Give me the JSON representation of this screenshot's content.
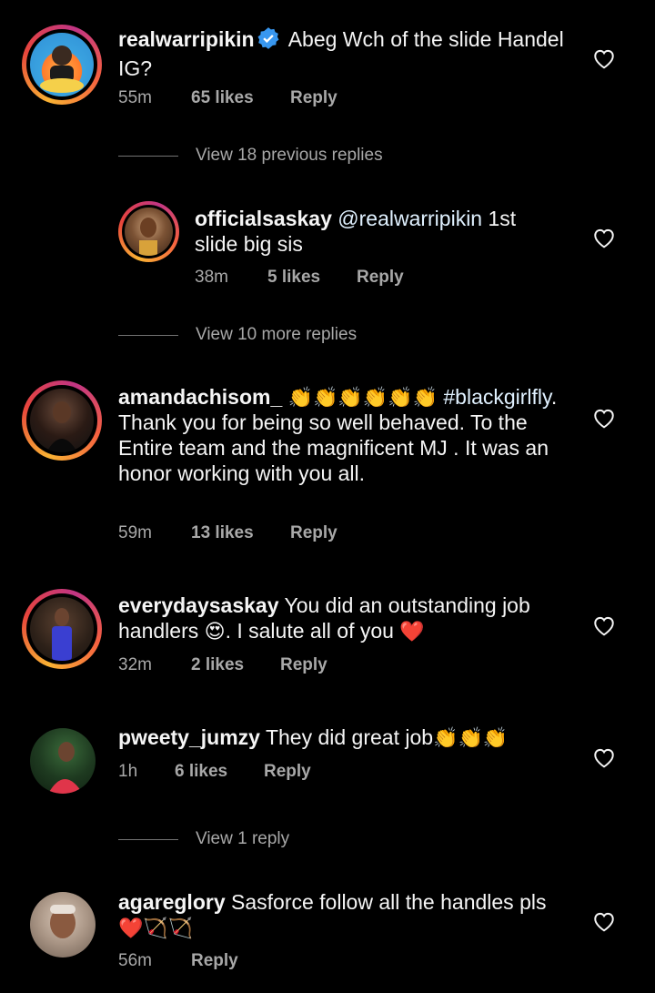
{
  "comments": [
    {
      "username": "realwarripikin",
      "verified": true,
      "text": "Abeg Wch of the slide Handel IG?",
      "time": "55m",
      "likes": "65 likes",
      "reply": "Reply"
    },
    {
      "username": "officialsaskay",
      "mention": "@realwarripikin",
      "text": "1st slide big sis",
      "time": "38m",
      "likes": "5 likes",
      "reply": "Reply"
    },
    {
      "username": "amandachisom_",
      "emojis": "👏👏👏👏👏👏",
      "hashtag": "#blackgirlfly",
      "text": ". Thank you for being so well behaved.  To the Entire team and the magnificent MJ . It was an honor working with you all.",
      "time": "59m",
      "likes": "13 likes",
      "reply": "Reply"
    },
    {
      "username": "everydaysaskay",
      "text_a": "You did an outstanding job handlers",
      "emoji_a": "😍",
      "text_b": ". I salute all of you",
      "emoji_b": "❤️",
      "time": "32m",
      "likes": "2 likes",
      "reply": "Reply"
    },
    {
      "username": "pweety_jumzy",
      "text": "They did great job",
      "emojis": "👏👏👏",
      "time": "1h",
      "likes": "6 likes",
      "reply": "Reply"
    },
    {
      "username": "agareglory",
      "text": "Sasforce follow all the handles pls",
      "emojis": "❤️🏹🏹",
      "time": "56m",
      "reply": "Reply"
    }
  ],
  "view_links": {
    "previous": "View 18 previous replies",
    "more": "View 10 more replies",
    "one": "View 1 reply"
  },
  "colors": {
    "background": "#000000",
    "text": "#f5f5f5",
    "secondary": "#a8a8a8",
    "verified": "#3897f0",
    "heart_red": "#ed4956"
  },
  "icons": [
    "heart-outline-icon",
    "verified-badge-icon"
  ]
}
